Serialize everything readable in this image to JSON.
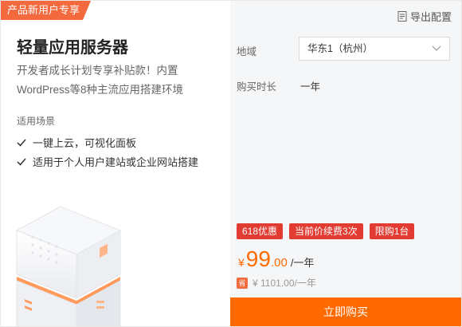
{
  "promo_tag": "产品新用户专享",
  "product": {
    "title": "轻量应用服务器",
    "description": "开发者成长计划专享补贴款！内置WordPress等8种主流应用搭建环境",
    "scenario_title": "适用场景",
    "features": [
      "一键上云，可视化面板",
      "适用于个人用户建站或企业网站搭建"
    ]
  },
  "config": {
    "export_label": "导出配置",
    "region_label": "地域",
    "region_value": "华东1（杭州）",
    "duration_label": "购买时长",
    "duration_value": "一年"
  },
  "badges": [
    "618优惠",
    "当前价续费3次",
    "限购1台"
  ],
  "pricing": {
    "currency": "¥",
    "price_int": "99",
    "price_dec": ".00",
    "unit": "/一年",
    "original_tag": "省",
    "original_price": "¥ 1101.00",
    "original_unit": "/一年"
  },
  "buy_label": "立即购买",
  "colors": {
    "accent": "#ff6a00",
    "promo": "#f26a3d",
    "badge": "#e23b32"
  }
}
